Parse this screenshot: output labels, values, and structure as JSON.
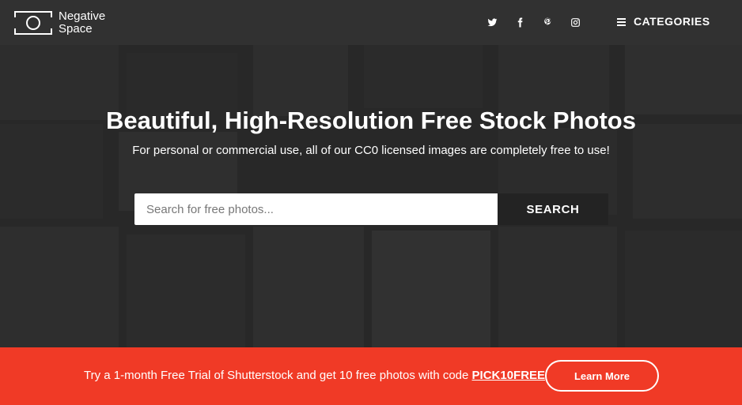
{
  "header": {
    "logo": {
      "line1": "Negative",
      "line2": "Space"
    },
    "social_icons": [
      "twitter-icon",
      "facebook-icon",
      "pinterest-icon",
      "instagram-icon"
    ],
    "categories_label": "CATEGORIES"
  },
  "hero": {
    "title": "Beautiful, High-Resolution Free Stock Photos",
    "subtitle": "For personal or commercial use, all of our CC0 licensed images are completely free to use!",
    "search": {
      "placeholder": "Search for free photos...",
      "value": "",
      "button_label": "SEARCH"
    }
  },
  "promo": {
    "text_before": "Try a 1-month Free Trial of Shutterstock and get 10 free photos with code ",
    "code": "PICK10FREE",
    "button_label": "Learn More",
    "background_color": "#f03a26"
  },
  "colors": {
    "header_bg": "#313131",
    "search_button_bg": "#232323"
  }
}
